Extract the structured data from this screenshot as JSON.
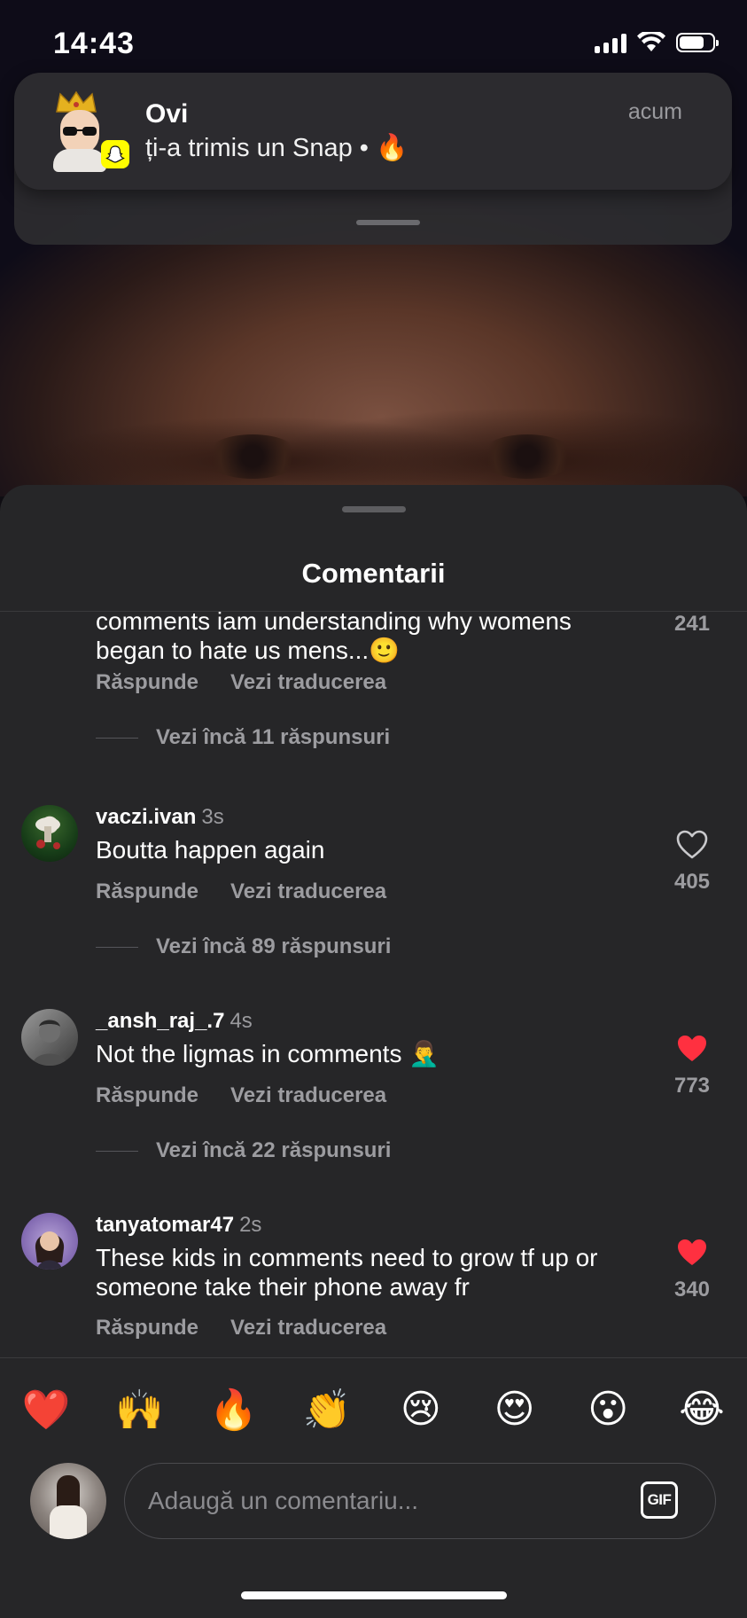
{
  "status_bar": {
    "time": "14:43",
    "battery_level": 0.75
  },
  "notification": {
    "sender": "Ovi",
    "message": "ți-a trimis un Snap •",
    "emoji": "🔥",
    "time": "acum",
    "app_icon": "snapchat-icon"
  },
  "sheet": {
    "title": "Comentarii"
  },
  "comments": [
    {
      "text_lines": [
        "comments iam understanding why womens",
        "began to hate us mens...🙂"
      ],
      "like_count": "241",
      "reply_label": "Răspunde",
      "translate_label": "Vezi traducerea",
      "more_replies": "Vezi încă 11 răspunsuri"
    },
    {
      "username": "vaczi.ivan",
      "time": "3s",
      "text": "Boutta happen again",
      "like_count": "405",
      "liked": false,
      "reply_label": "Răspunde",
      "translate_label": "Vezi traducerea",
      "more_replies": "Vezi încă 89 răspunsuri"
    },
    {
      "username": "_ansh_raj_.7",
      "time": "4s",
      "text": "Not the ligmas in comments 🤦‍♂️",
      "like_count": "773",
      "liked": true,
      "reply_label": "Răspunde",
      "translate_label": "Vezi traducerea",
      "more_replies": "Vezi încă 22 răspunsuri"
    },
    {
      "username": "tanyatomar47",
      "time": "2s",
      "text_lines": [
        "These kids in comments need to grow tf up or",
        "someone take their phone away fr"
      ],
      "like_count": "340",
      "liked": true,
      "reply_label": "Răspunde",
      "translate_label": "Vezi traducerea"
    }
  ],
  "reactions": [
    "❤️",
    "🙌",
    "🔥",
    "👏",
    "😢",
    "😍",
    "😮",
    "😂"
  ],
  "composer": {
    "placeholder": "Adaugă un comentariu...",
    "gif_label": "GIF"
  },
  "colors": {
    "liked_heart": "#ff3040",
    "sheet_bg": "#262628",
    "muted_text": "#9c9ca0"
  }
}
